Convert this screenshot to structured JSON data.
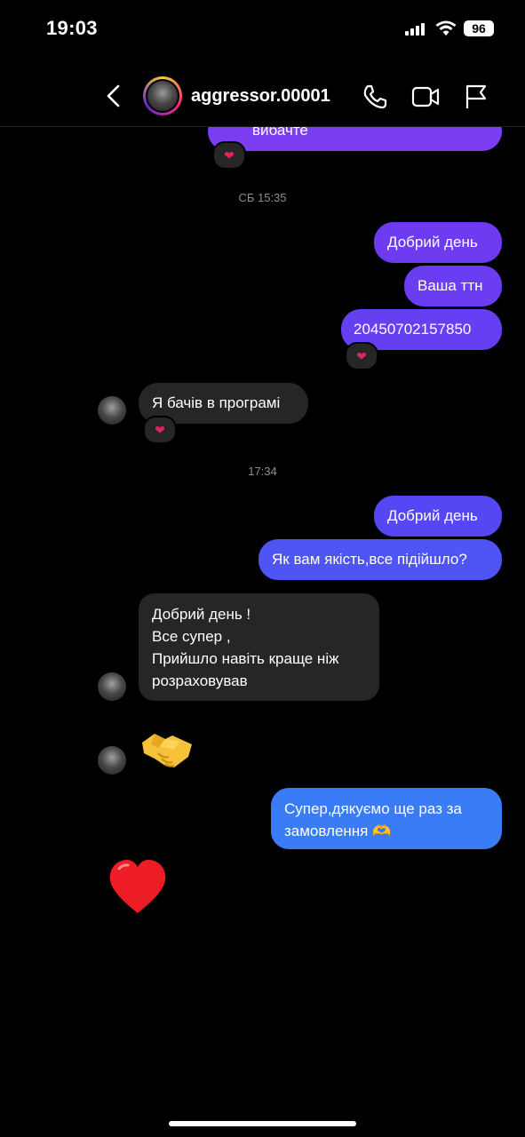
{
  "status": {
    "time": "19:03",
    "battery": "96"
  },
  "header": {
    "username": "aggressor.00001"
  },
  "messages": {
    "top_partial": "вибачте",
    "ts1": "СБ 15:35",
    "m1": "Добрий день",
    "m2": "Ваша ттн",
    "m3": "20450702157850",
    "r1": "Я бачів в програмі",
    "ts2": "17:34",
    "m4": "Добрий день",
    "m5": "Як вам якість,все підійшло?",
    "r2_line1": "Добрий день !",
    "r2_line2": "Все супер ,",
    "r2_line3": "Прийшло навіть краще ніж",
    "r2_line4": "розраховував",
    "m6_line1": "Супер,дякуємо ще раз за",
    "m6_line2": "замовлення 🫶"
  },
  "icons": [
    "back-chevron-icon",
    "phone-icon",
    "video-icon",
    "flag-icon",
    "heart-icon",
    "handshake-icon"
  ],
  "colors": {
    "bubble_purple": "#6b3cf2",
    "bubble_blue": "#3478f6",
    "incoming": "#262626"
  }
}
